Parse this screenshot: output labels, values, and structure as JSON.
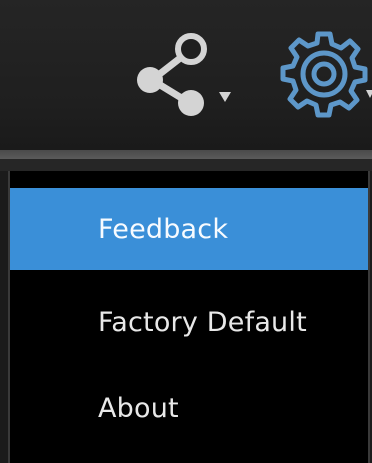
{
  "toolbar": {
    "icons": [
      "share-icon",
      "settings-gear-icon"
    ],
    "icon_color": "#d4d4d4",
    "gear_color": "#5d97c9"
  },
  "menu": {
    "items": [
      {
        "label": "Feedback",
        "selected": true
      },
      {
        "label": "Factory Default",
        "selected": false
      },
      {
        "label": "About",
        "selected": false
      }
    ],
    "highlight_color": "#3a8fd8"
  }
}
